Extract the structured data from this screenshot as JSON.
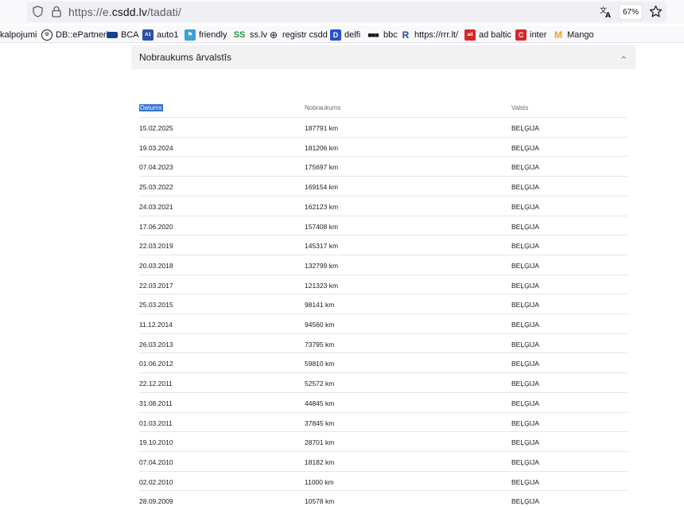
{
  "browser": {
    "url_prefix": "https://e.",
    "url_domain": "csdd.lv",
    "url_path": "/tadati/",
    "zoom": "67%"
  },
  "bookmarks": [
    {
      "label": "kalpojumi",
      "icon": "none"
    },
    {
      "label": "DB::ePartneri",
      "icon": "db-icon"
    },
    {
      "label": "BCA",
      "icon": "bca-icon"
    },
    {
      "label": "auto1",
      "icon": "auto1-icon"
    },
    {
      "label": "friendly",
      "icon": "friendly-icon"
    },
    {
      "label": "ss.lv",
      "icon": "ss-icon"
    },
    {
      "label": "registr csdd",
      "icon": "globe-icon"
    },
    {
      "label": "delfi",
      "icon": "delfi-icon"
    },
    {
      "label": "bbc",
      "icon": "bbc-icon"
    },
    {
      "label": "https://rrr.lt/",
      "icon": "rrr-icon"
    },
    {
      "label": "ad baltic",
      "icon": "adbaltic-icon"
    },
    {
      "label": "inter",
      "icon": "inter-icon"
    },
    {
      "label": "Mango",
      "icon": "mango-icon"
    }
  ],
  "panel": {
    "title": "Nobraukums ārvalstīs"
  },
  "table": {
    "headers": [
      "Datums",
      "Nobraukums",
      "Valsts"
    ],
    "rows": [
      [
        "15.02.2025",
        "187791 km",
        "BEĻĢIJA"
      ],
      [
        "19.03.2024",
        "181206 km",
        "BEĻĢIJA"
      ],
      [
        "07.04.2023",
        "175697 km",
        "BEĻĢIJA"
      ],
      [
        "25.03.2022",
        "169154 km",
        "BEĻĢIJA"
      ],
      [
        "24.03.2021",
        "162123 km",
        "BEĻĢIJA"
      ],
      [
        "17.06.2020",
        "157408 km",
        "BEĻĢIJA"
      ],
      [
        "22.03.2019",
        "145317 km",
        "BEĻĢIJA"
      ],
      [
        "20.03.2018",
        "132799 km",
        "BEĻĢIJA"
      ],
      [
        "22.03.2017",
        "121323 km",
        "BEĻĢIJA"
      ],
      [
        "25.03.2015",
        "98141 km",
        "BEĻĢIJA"
      ],
      [
        "11.12.2014",
        "94560 km",
        "BEĻĢIJA"
      ],
      [
        "26.03.2013",
        "73795 km",
        "BEĻĢIJA"
      ],
      [
        "01.06.2012",
        "59810 km",
        "BEĻĢIJA"
      ],
      [
        "22.12.2011",
        "52572 km",
        "BEĻĢIJA"
      ],
      [
        "31.08.2011",
        "44845 km",
        "BEĻĢIJA"
      ],
      [
        "01.03.2011",
        "37845 km",
        "BEĻĢIJA"
      ],
      [
        "19.10.2010",
        "28701 km",
        "BEĻĢIJA"
      ],
      [
        "07.04.2010",
        "18182 km",
        "BEĻĢIJA"
      ],
      [
        "02.02.2010",
        "11000 km",
        "BEĻĢIJA"
      ],
      [
        "28.09.2009",
        "10578 km",
        "BEĻĢIJA"
      ]
    ]
  }
}
